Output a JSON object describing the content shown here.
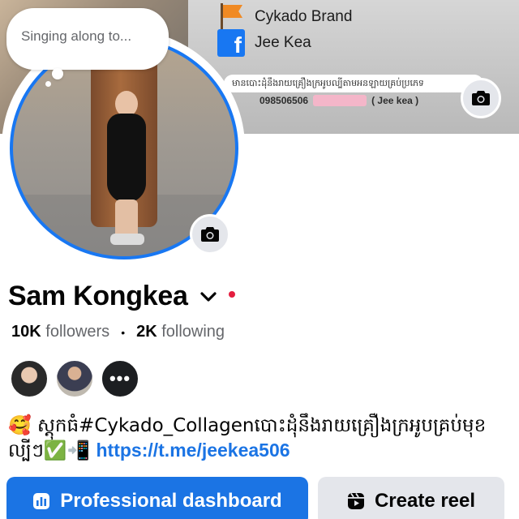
{
  "cover": {
    "brand_label": "Cykado Brand",
    "fb_label": "Jee Kea",
    "fb_letter": "f",
    "banner_text": "មានបោះដុំនឹងរាយគ្រឿងក្រអូបល្បីតាមអនឡាយគ្រប់ប្រភេទ",
    "phone_text": "098506506",
    "phone_suffix": "( Jee kea )"
  },
  "status_bubble": {
    "text": "Singing along to..."
  },
  "profile": {
    "name": "Sam Kongkea",
    "followers_count": "10K",
    "followers_label": "followers",
    "separator": "•",
    "following_count": "2K",
    "following_label": "following",
    "more_friends_label": "•••"
  },
  "bio": {
    "text": "🥰 ស្តុកធំ#Cykado_Collagenបោះដុំនឹងរាយគ្រឿងក្រអូបគ្រប់មុខល្បីៗ✅📲 ",
    "link": "https://t.me/jeekea506"
  },
  "actions": {
    "professional_dashboard": "Professional dashboard",
    "create_reel": "Create reel"
  },
  "colors": {
    "accent": "#1b74e4",
    "notification_dot": "#e41e3f"
  },
  "icons": [
    "camera-icon",
    "chevron-down-icon",
    "dashboard-icon",
    "reel-icon",
    "facebook-icon",
    "flag-icon"
  ]
}
